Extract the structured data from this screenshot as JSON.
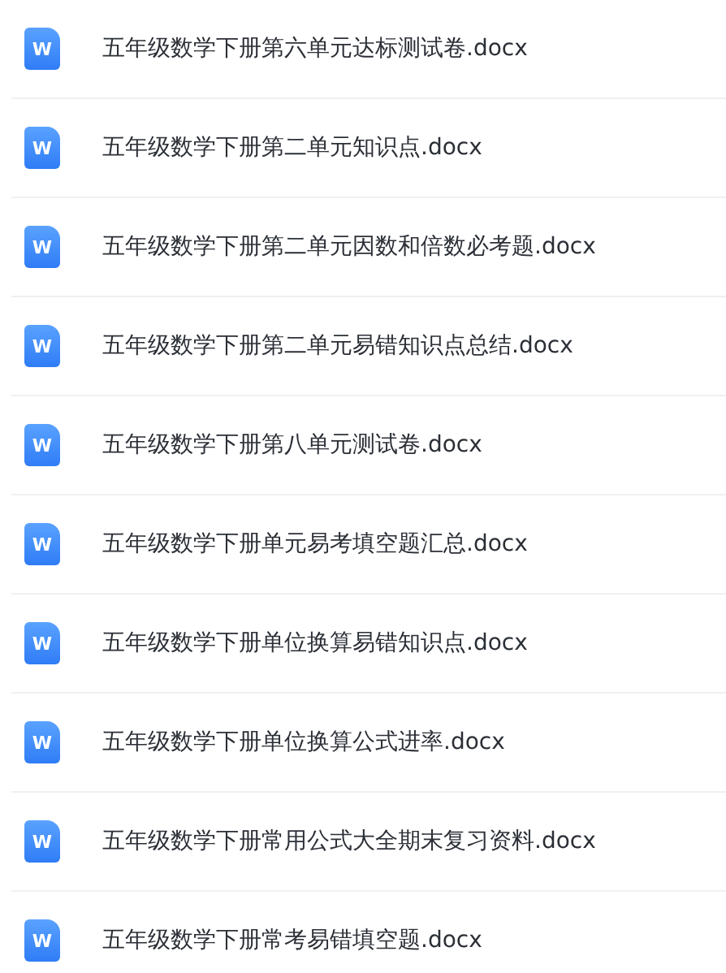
{
  "files": [
    {
      "name": "五年级数学下册第六单元达标测试卷.docx",
      "badge": "W"
    },
    {
      "name": "五年级数学下册第二单元知识点.docx",
      "badge": "W"
    },
    {
      "name": "五年级数学下册第二单元因数和倍数必考题.docx",
      "badge": "W"
    },
    {
      "name": "五年级数学下册第二单元易错知识点总结.docx",
      "badge": "W"
    },
    {
      "name": "五年级数学下册第八单元测试卷.docx",
      "badge": "W"
    },
    {
      "name": "五年级数学下册单元易考填空题汇总.docx",
      "badge": "W"
    },
    {
      "name": "五年级数学下册单位换算易错知识点.docx",
      "badge": "W"
    },
    {
      "name": "五年级数学下册单位换算公式进率.docx",
      "badge": "W"
    },
    {
      "name": "五年级数学下册常用公式大全期末复习资料.docx",
      "badge": "W"
    },
    {
      "name": "五年级数学下册常考易错填空题.docx",
      "badge": "W"
    }
  ]
}
